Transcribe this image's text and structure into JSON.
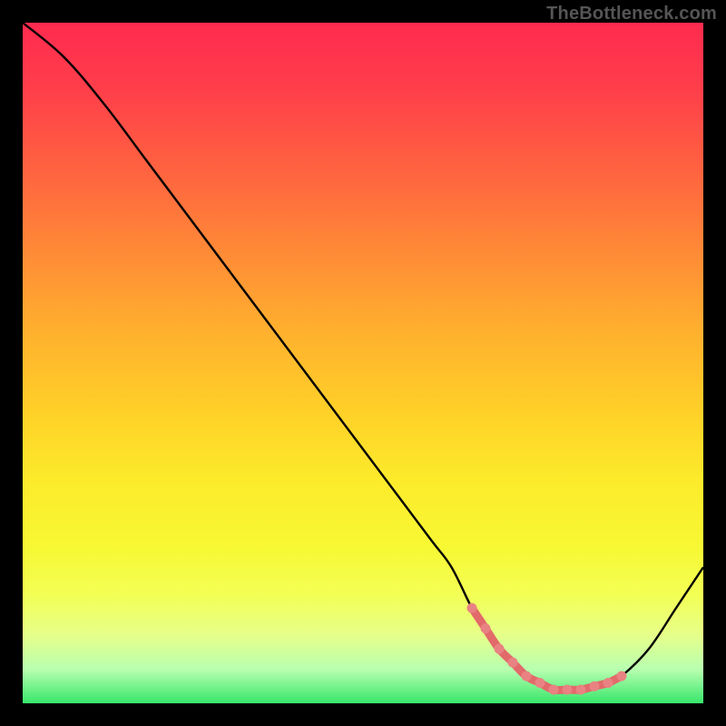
{
  "watermark": "TheBottleneck.com",
  "chart_data": {
    "type": "line",
    "title": "",
    "xlabel": "",
    "ylabel": "",
    "xlim": [
      0,
      100
    ],
    "ylim": [
      0,
      100
    ],
    "series": [
      {
        "name": "bottleneck-curve",
        "x": [
          0,
          6,
          12,
          18,
          24,
          30,
          36,
          42,
          48,
          54,
          60,
          63,
          66,
          68,
          70,
          72,
          74,
          76,
          78,
          80,
          82,
          84,
          86,
          88,
          92,
          96,
          100
        ],
        "values": [
          100,
          95,
          88,
          80,
          72,
          64,
          56,
          48,
          40,
          32,
          24,
          20,
          14,
          11,
          8,
          6,
          4,
          3,
          2,
          2,
          2,
          2.5,
          3,
          4,
          8,
          14,
          20
        ]
      }
    ],
    "highlight": {
      "name": "optimal-range",
      "x": [
        66,
        68,
        70,
        72,
        74,
        76,
        78,
        80,
        82,
        84,
        86,
        88
      ],
      "values": [
        14,
        11,
        8,
        6,
        4,
        3,
        2,
        2,
        2,
        2.5,
        3,
        4
      ]
    },
    "background_gradient": {
      "top": "#ff2a4f",
      "bottom": "#37e66b",
      "meaning": "severity (red high → green low)"
    }
  },
  "colors": {
    "curve_stroke": "#000000",
    "highlight_stroke": "#e26a6a",
    "highlight_dot_fill": "#e98282",
    "frame": "#000000"
  }
}
